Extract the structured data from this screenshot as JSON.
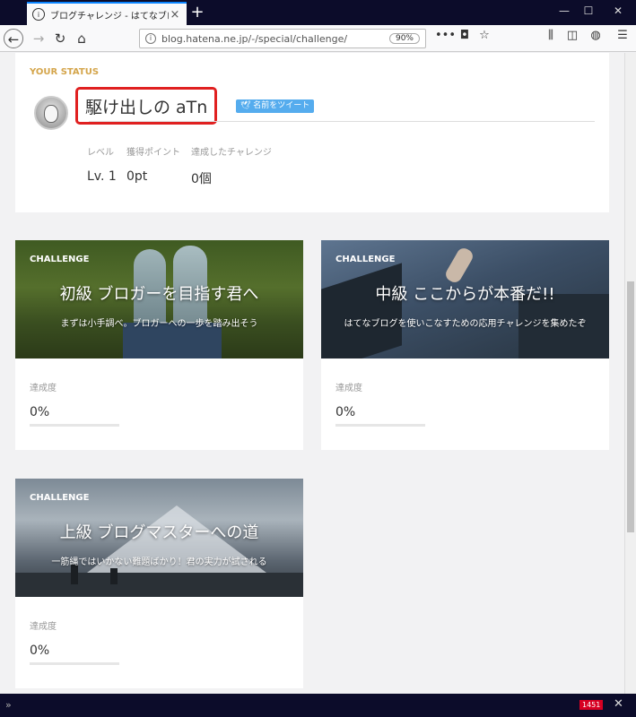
{
  "browser": {
    "tab_title": "ブログチャレンジ - はてなブログ",
    "tab_close": "×",
    "new_tab": "+",
    "url_host": "blog.hatena.ne.jp",
    "url_path": "/-/special/challenge/",
    "zoom": "90%",
    "menu_dots": "•••",
    "win_min": "—",
    "win_max": "☐",
    "win_close": "✕"
  },
  "status": {
    "label": "YOUR STATUS",
    "username": "駆け出しの aTn",
    "tweet_button": "名前をツイート",
    "stats": [
      {
        "header": "レベル",
        "value": "Lv. 1"
      },
      {
        "header": "獲得ポイント",
        "value": "0pt"
      },
      {
        "header": "達成したチャレンジ",
        "value": "0個"
      }
    ]
  },
  "challenges": [
    {
      "tag": "CHALLENGE",
      "title": "初級 ブロガーを目指す君へ",
      "subtitle": "まずは小手調べ。ブロガーへの一歩を踏み出そう",
      "progress_label": "達成度",
      "progress": "0%",
      "progress_fraction": 0
    },
    {
      "tag": "CHALLENGE",
      "title": "中級 ここからが本番だ!!",
      "subtitle": "はてなブログを使いこなすための応用チャレンジを集めたぞ",
      "progress_label": "達成度",
      "progress": "0%",
      "progress_fraction": 0
    },
    {
      "tag": "CHALLENGE",
      "title": "上級 ブログマスターへの道",
      "subtitle": "一筋縄ではいかない難題ばかり！君の実力が試される",
      "progress_label": "達成度",
      "progress": "0%",
      "progress_fraction": 0
    }
  ],
  "bottom": {
    "badge": "1451",
    "close": "✕",
    "arrows": "»"
  },
  "colors": {
    "accent": "#d4a54b",
    "highlight": "#e02020",
    "twitter": "#55acee"
  }
}
